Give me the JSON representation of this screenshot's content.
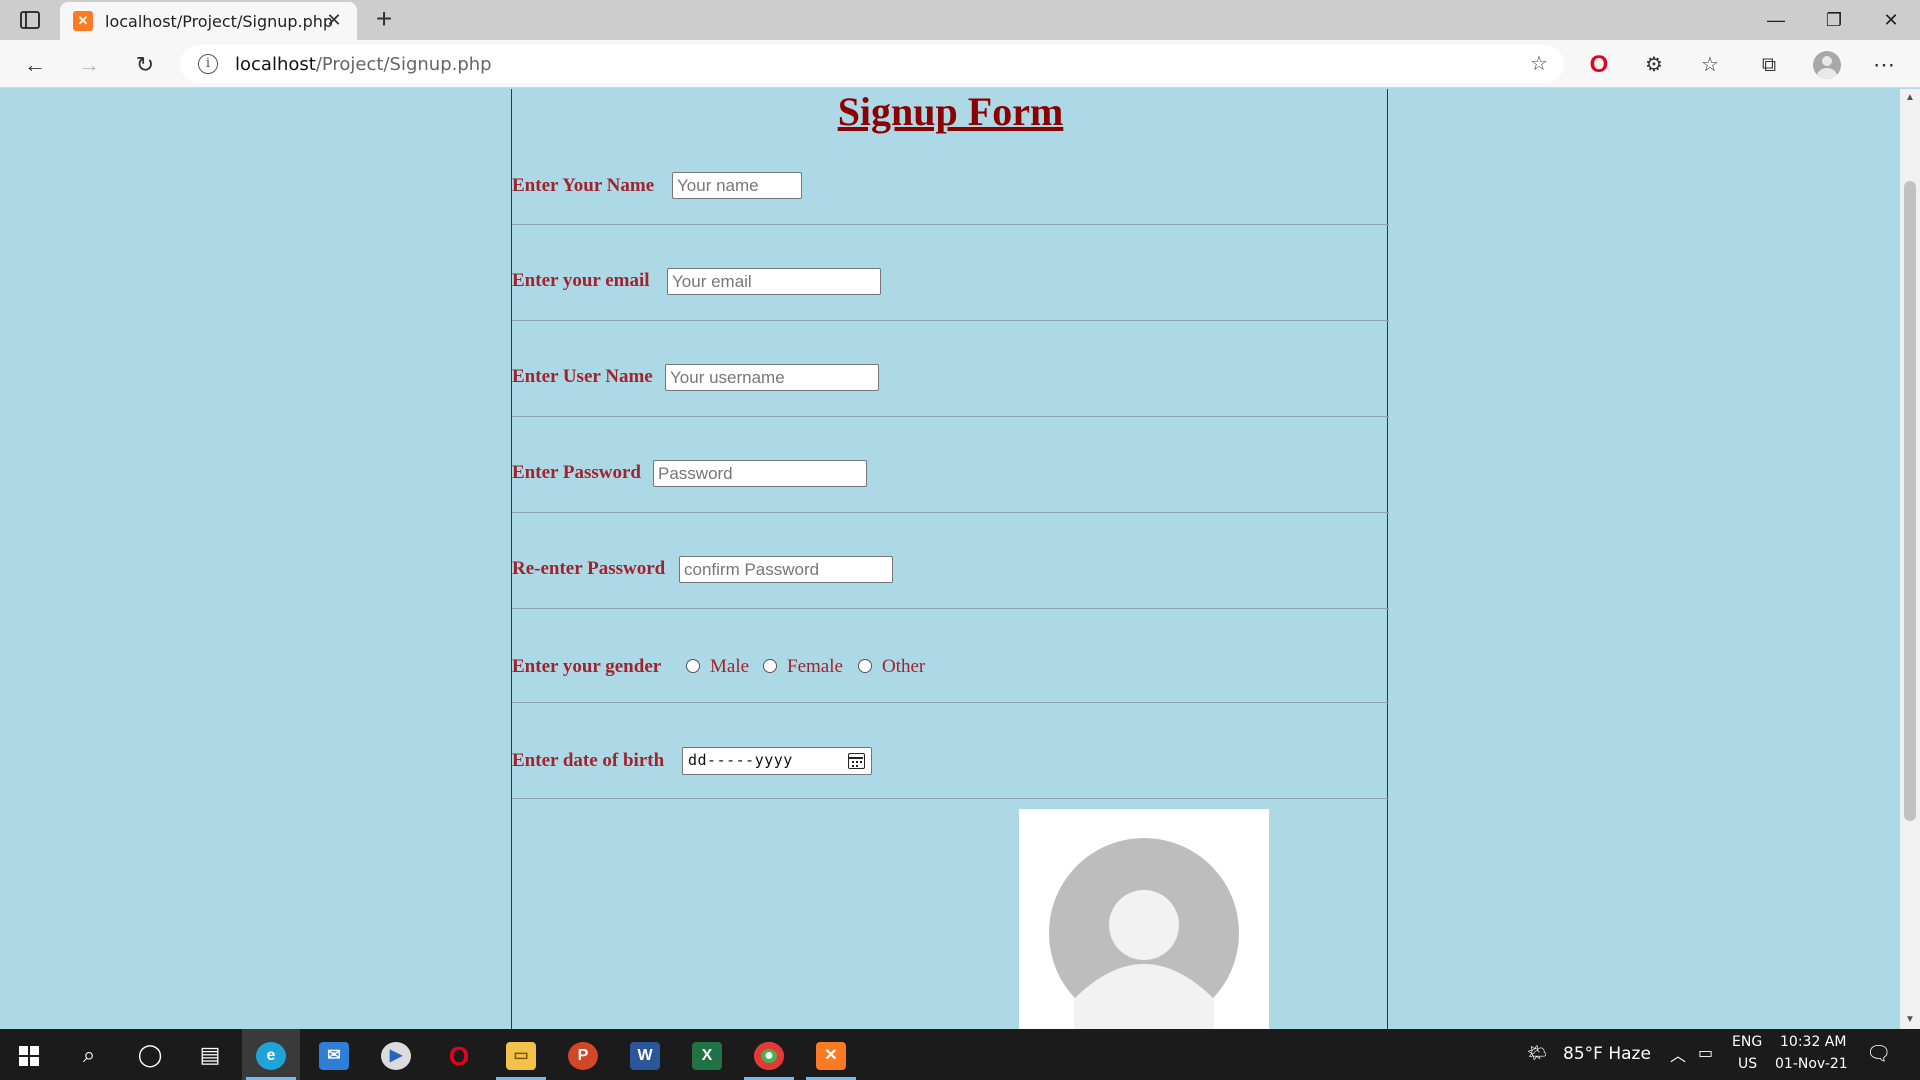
{
  "browser": {
    "tab_title": "localhost/Project/Signup.php",
    "url_host": "localhost",
    "url_path": "/Project/Signup.php"
  },
  "form": {
    "heading": "Signup Form",
    "fields": [
      {
        "label": "Enter Your Name",
        "placeholder": "Your name"
      },
      {
        "label": "Enter your email",
        "placeholder": "Your email"
      },
      {
        "label": "Enter User Name",
        "placeholder": "Your username"
      },
      {
        "label": "Enter Password",
        "placeholder": "Password"
      },
      {
        "label": "Re-enter Password",
        "placeholder": "confirm Password"
      }
    ],
    "gender": {
      "label": "Enter your gender",
      "options": [
        "Male",
        "Female",
        "Other"
      ]
    },
    "dob": {
      "label": "Enter date of birth",
      "placeholder": "dd-----yyyy"
    }
  },
  "taskbar": {
    "weather": "85°F  Haze",
    "language": "ENG",
    "region": "US",
    "time": "10:32 AM",
    "date": "01-Nov-21"
  },
  "colors": {
    "page_background": "#add8e6",
    "heading": "#8b0000",
    "label": "#a0232d"
  }
}
